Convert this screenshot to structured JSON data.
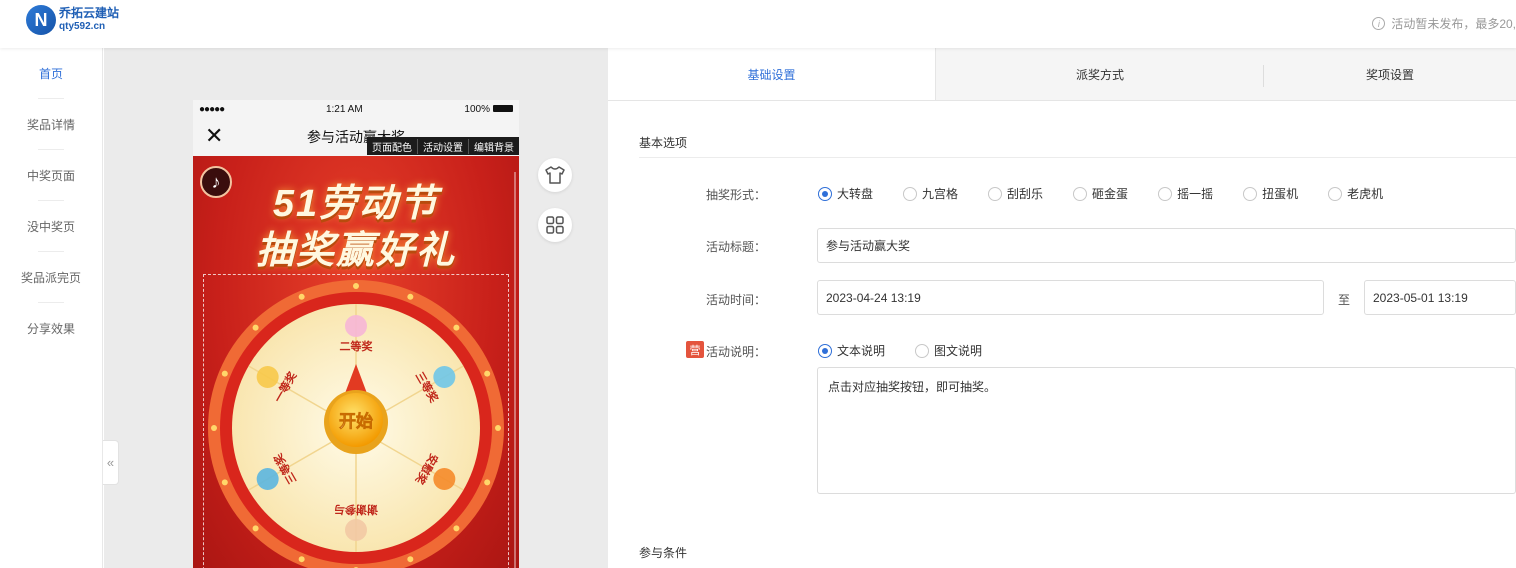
{
  "header": {
    "logo_mark": "N",
    "logo_name": "乔拓云建站",
    "logo_url": "qty592.cn",
    "notice": "活动暂未发布，最多20,"
  },
  "sidenav": {
    "items": [
      {
        "label": "首页",
        "active": true
      },
      {
        "label": "奖品详情"
      },
      {
        "label": "中奖页面"
      },
      {
        "label": "没中奖页"
      },
      {
        "label": "奖品派完页"
      },
      {
        "label": "分享效果"
      }
    ]
  },
  "collapse_icon": "«",
  "phone": {
    "signal": "●●●●●",
    "time": "1:21 AM",
    "battery": "100%",
    "close_icon": "✕",
    "title": "参与活动赢大奖",
    "toolbar": {
      "page_color": "页面配色",
      "activity_settings": "活动设置",
      "edit_background": "编辑背景"
    },
    "music_icon": "♪",
    "headline1": "51劳动节",
    "headline2": "抽奖赢好礼",
    "start_label": "开始",
    "prizes": [
      "二等奖",
      "三等奖",
      "安慰奖",
      "谢谢参与",
      "三等奖",
      "一等奖"
    ]
  },
  "side_buttons": {
    "theme_icon": "shirt-icon",
    "layout_icon": "grid-icon"
  },
  "tabs": [
    {
      "label": "基础设置",
      "active": true
    },
    {
      "label": "派奖方式"
    },
    {
      "label": "奖项设置"
    }
  ],
  "form": {
    "section_basic": "基本选项",
    "lottery_type_label": "抽奖形式：",
    "lottery_types": [
      {
        "label": "大转盘",
        "selected": true
      },
      {
        "label": "九宫格"
      },
      {
        "label": "刮刮乐"
      },
      {
        "label": "砸金蛋"
      },
      {
        "label": "摇一摇"
      },
      {
        "label": "扭蛋机"
      },
      {
        "label": "老虎机"
      }
    ],
    "title_label": "活动标题：",
    "title_value": "参与活动赢大奖",
    "time_label": "活动时间：",
    "start_time": "2023-04-24 13:19",
    "to_label": "至",
    "end_time": "2023-05-01 13:19",
    "badge": "营",
    "desc_label": "活动说明：",
    "desc_types": [
      {
        "label": "文本说明",
        "selected": true
      },
      {
        "label": "图文说明"
      }
    ],
    "desc_value": "点击对应抽奖按钮，即可抽奖。",
    "section_conditions": "参与条件"
  },
  "colors": {
    "accent": "#2f6fd8",
    "wheel_red": "#d9261c",
    "wheel_cream": "#fdf2c6",
    "button_yellow": "#f7b500"
  }
}
